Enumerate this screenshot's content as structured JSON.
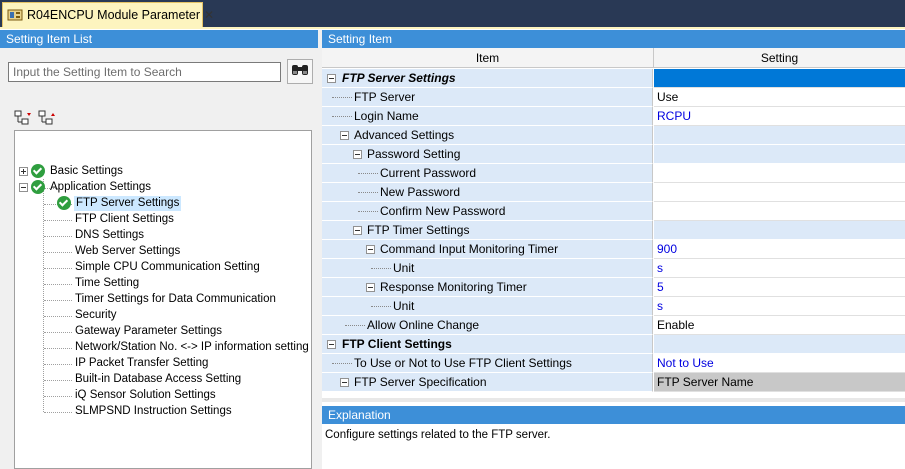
{
  "tab": {
    "title": "R04ENCPU Module Parameter",
    "close": "✕"
  },
  "left": {
    "header": "Setting Item List",
    "search_placeholder": "Input the Setting Item to Search",
    "tree": [
      {
        "label": "Basic Settings",
        "level": 0,
        "expander": "plus",
        "check": true
      },
      {
        "label": "Application Settings",
        "level": 0,
        "expander": "minus",
        "check": true
      },
      {
        "label": "FTP Server Settings",
        "level": 1,
        "check": true,
        "selected": true
      },
      {
        "label": "FTP Client Settings",
        "level": 1
      },
      {
        "label": "DNS Settings",
        "level": 1
      },
      {
        "label": "Web Server Settings",
        "level": 1
      },
      {
        "label": "Simple CPU Communication Setting",
        "level": 1
      },
      {
        "label": "Time Setting",
        "level": 1
      },
      {
        "label": "Timer Settings for Data Communication",
        "level": 1
      },
      {
        "label": "Security",
        "level": 1
      },
      {
        "label": "Gateway Parameter Settings",
        "level": 1
      },
      {
        "label": "Network/Station No. <-> IP information setting",
        "level": 1
      },
      {
        "label": "IP Packet Transfer Setting",
        "level": 1
      },
      {
        "label": "Built-in Database Access Setting",
        "level": 1
      },
      {
        "label": "iQ Sensor Solution Settings",
        "level": 1
      },
      {
        "label": "SLMPSND Instruction Settings",
        "level": 1
      }
    ]
  },
  "right": {
    "header": "Setting Item",
    "col_item": "Item",
    "col_setting": "Setting",
    "rows": [
      {
        "item": "FTP Server Settings",
        "setting": "",
        "style": "group"
      },
      {
        "item": "FTP Server",
        "setting": "Use",
        "style": "normal"
      },
      {
        "item": "Login Name",
        "setting": "RCPU",
        "style": "blue"
      },
      {
        "item": "Advanced Settings",
        "setting": "",
        "style": "sub"
      },
      {
        "item": "Password Setting",
        "setting": "",
        "style": "sub"
      },
      {
        "item": "Current Password",
        "setting": "",
        "style": "normal"
      },
      {
        "item": "New Password",
        "setting": "",
        "style": "normal"
      },
      {
        "item": "Confirm New Password",
        "setting": "",
        "style": "normal"
      },
      {
        "item": "FTP Timer Settings",
        "setting": "",
        "style": "sub"
      },
      {
        "item": "Command Input Monitoring Timer",
        "setting": "900",
        "style": "blue"
      },
      {
        "item": "Unit",
        "setting": "s",
        "style": "blue"
      },
      {
        "item": "Response Monitoring Timer",
        "setting": "5",
        "style": "blue"
      },
      {
        "item": "Unit",
        "setting": "s",
        "style": "blue"
      },
      {
        "item": "Allow Online Change",
        "setting": "Enable",
        "style": "normal"
      },
      {
        "item": "FTP Client Settings",
        "setting": "",
        "style": "group2"
      },
      {
        "item": "To Use or Not to Use FTP Client Settings",
        "setting": "Not to Use",
        "style": "blue"
      },
      {
        "item": "FTP Server Specification",
        "setting": "FTP Server Name",
        "style": "gray"
      }
    ]
  },
  "explanation": {
    "header": "Explanation",
    "text": "Configure settings related to the FTP server."
  },
  "colors": {
    "header_blue": "#3d8fd8",
    "tab_bg": "#293955",
    "item_bg": "#dce9f8",
    "selected": "#0078d7"
  },
  "icons": [
    "module-parameter-icon",
    "binoculars-icon",
    "expand-all-icon",
    "collapse-all-icon",
    "check-icon"
  ]
}
